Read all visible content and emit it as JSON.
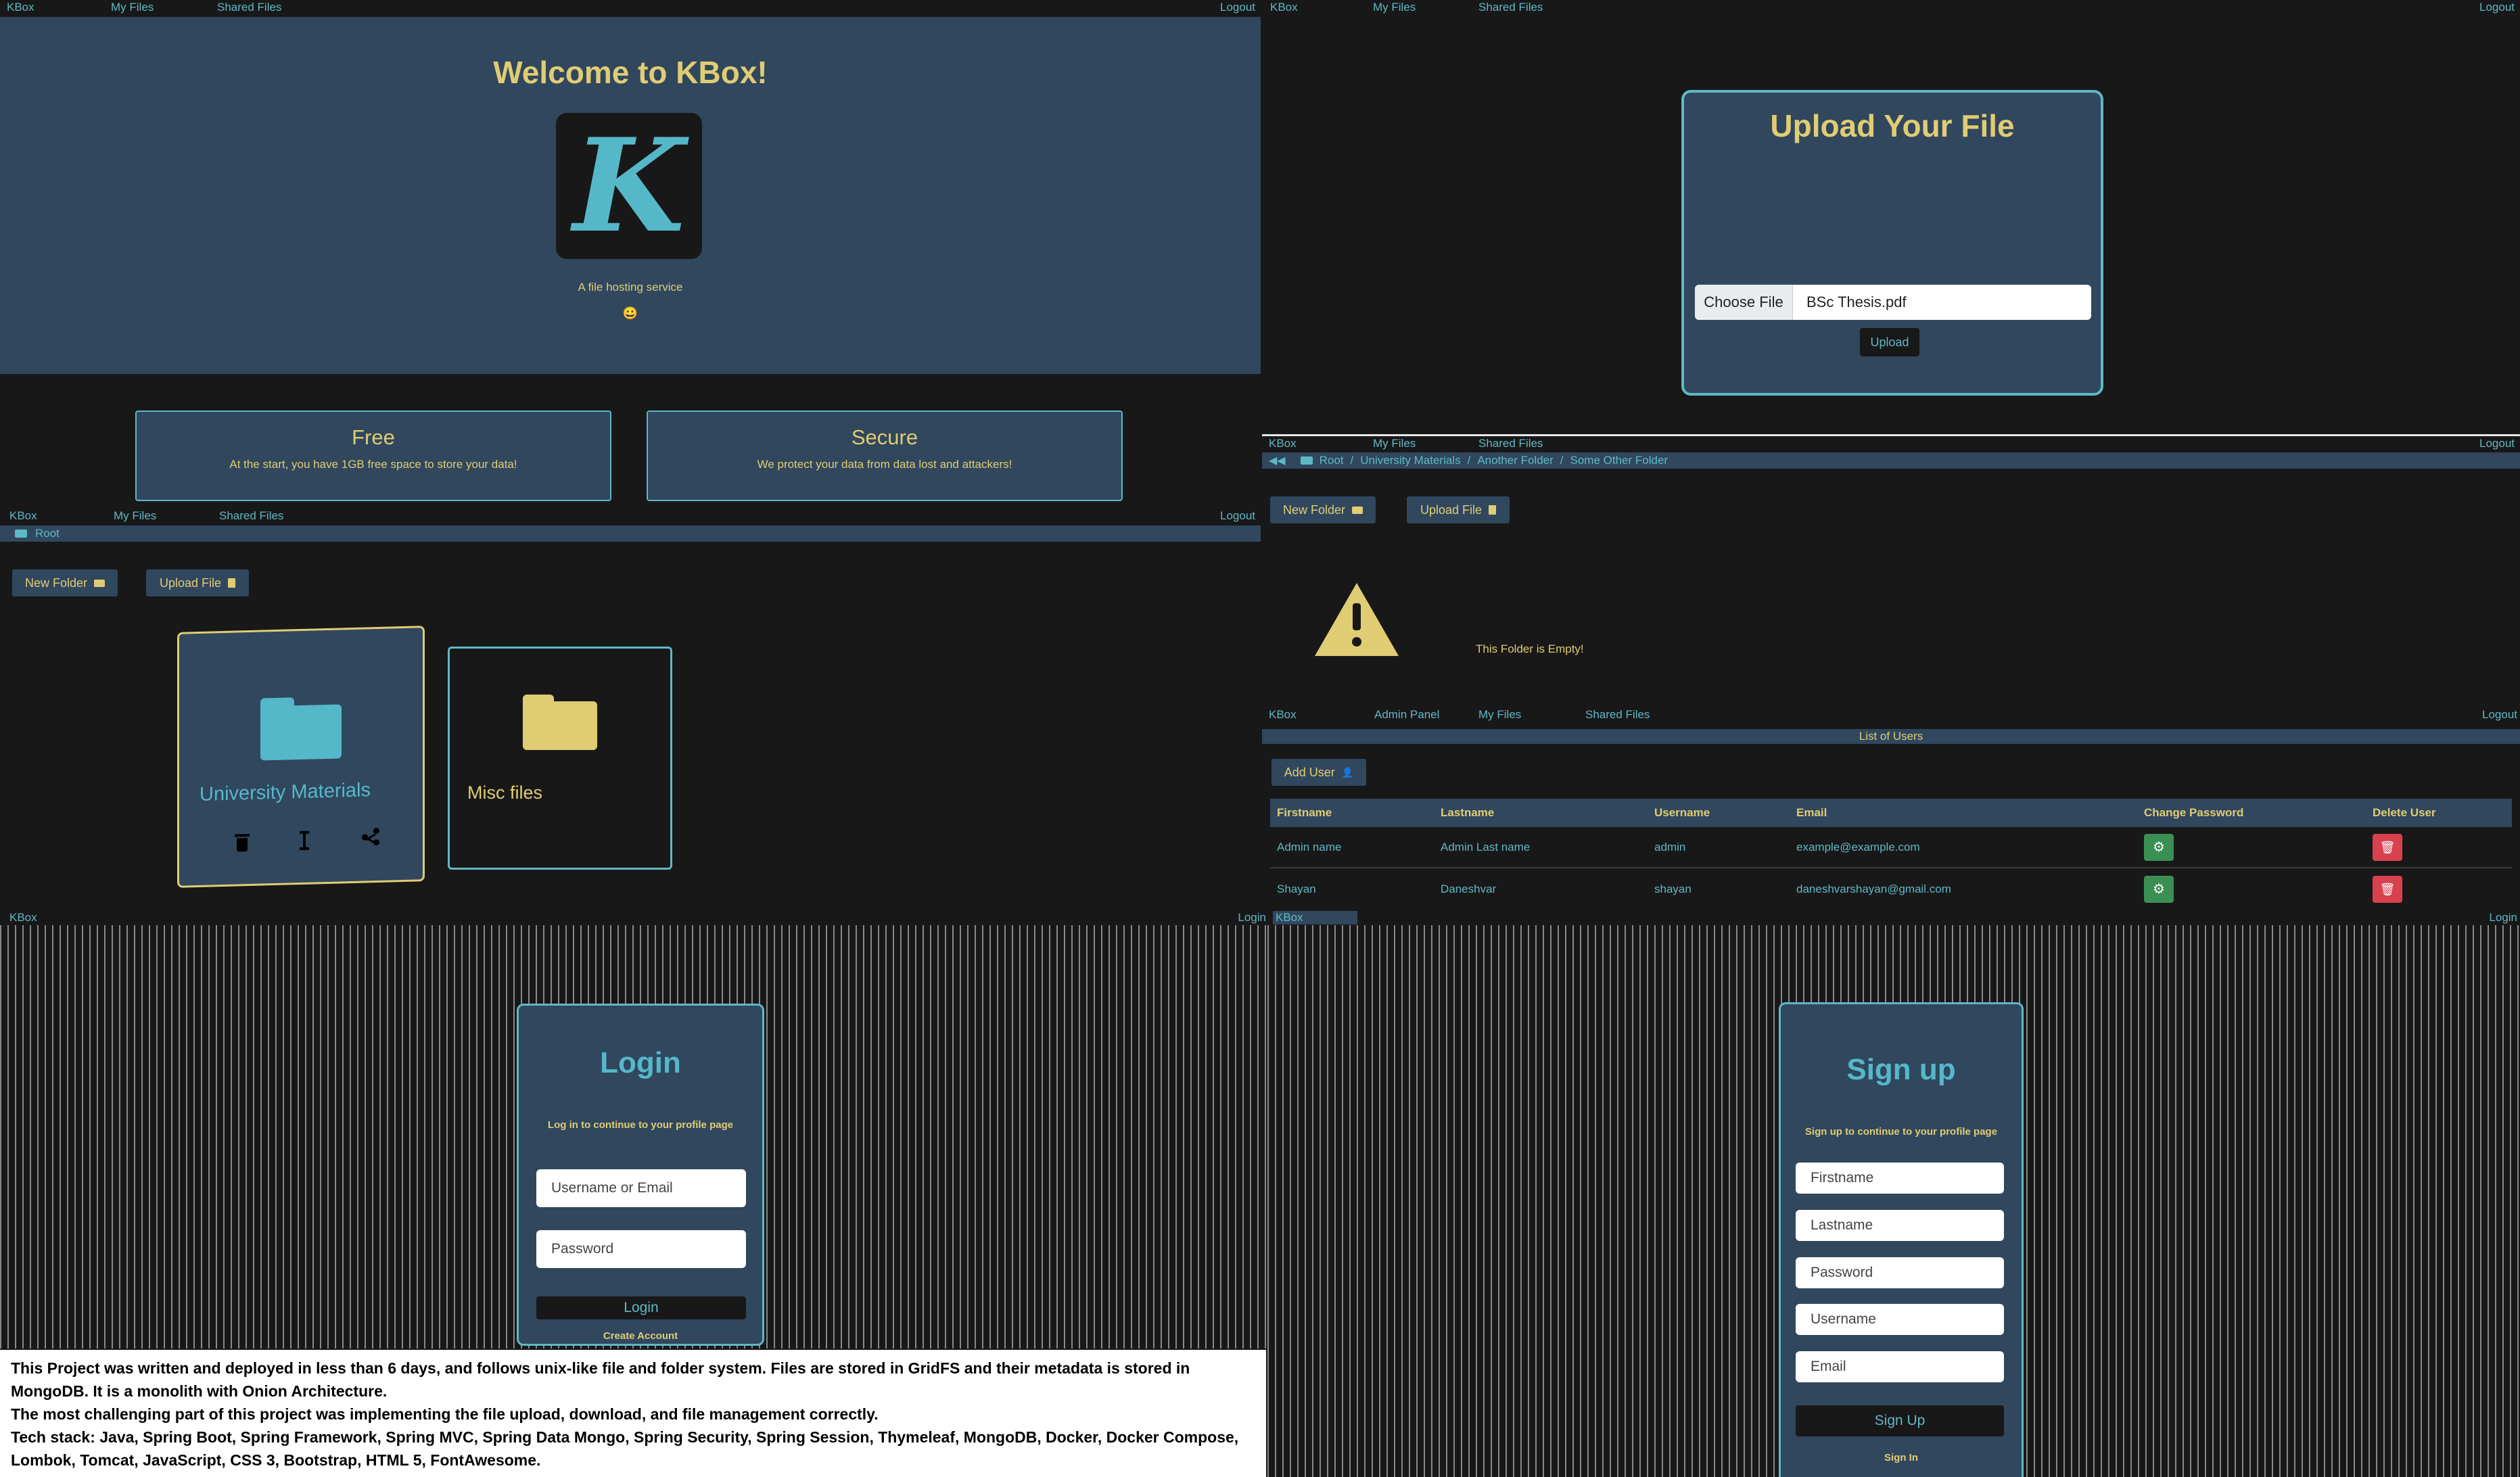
{
  "home": {
    "nav": {
      "brand": "KBox",
      "my_files": "My Files",
      "shared_files": "Shared Files",
      "logout": "Logout"
    },
    "welcome": "Welcome to KBox!",
    "logo_letter": "K",
    "tagline": "A file hosting service",
    "emoji": "😀",
    "features": [
      {
        "title": "Free",
        "text": "At the start, you have 1GB free space to store your data!"
      },
      {
        "title": "Secure",
        "text": "We protect your data from data lost and attackers!"
      }
    ]
  },
  "upload": {
    "nav": {
      "brand": "KBox",
      "my_files": "My Files",
      "shared_files": "Shared Files",
      "logout": "Logout"
    },
    "title": "Upload Your File",
    "choose_label": "Choose File",
    "file_name": "BSc Thesis.pdf",
    "upload_button": "Upload"
  },
  "files": {
    "nav": {
      "brand": "KBox",
      "my_files": "My Files",
      "shared_files": "Shared Files",
      "logout": "Logout"
    },
    "breadcrumb_root": "Root",
    "new_folder": "New Folder",
    "upload_file": "Upload File",
    "folders": [
      {
        "name": "University Materials",
        "color": "#55b8c9"
      },
      {
        "name": "Misc files",
        "color": "#e0cc73"
      }
    ]
  },
  "empty": {
    "nav": {
      "brand": "KBox",
      "my_files": "My Files",
      "shared_files": "Shared Files",
      "logout": "Logout"
    },
    "breadcrumb": [
      "Root",
      "University Materials",
      "Another Folder",
      "Some Other Folder"
    ],
    "new_folder": "New Folder",
    "upload_file": "Upload File",
    "message": "This Folder is Empty!"
  },
  "admin": {
    "nav": {
      "brand": "KBox",
      "admin_panel": "Admin Panel",
      "my_files": "My Files",
      "shared_files": "Shared Files",
      "logout": "Logout"
    },
    "header": "List of Users",
    "add_user": "Add User",
    "columns": [
      "Firstname",
      "Lastname",
      "Username",
      "Email",
      "Change Password",
      "Delete User"
    ],
    "rows": [
      {
        "firstname": "Admin name",
        "lastname": "Admin Last name",
        "username": "admin",
        "email": "example@example.com"
      },
      {
        "firstname": "Shayan",
        "lastname": "Daneshvar",
        "username": "shayan",
        "email": "daneshvarshayan@gmail.com"
      }
    ]
  },
  "login": {
    "nav": {
      "brand": "KBox",
      "login": "Login"
    },
    "title": "Login",
    "subtitle": "Log in to continue to your profile page",
    "username_placeholder": "Username or Email",
    "password_placeholder": "Password",
    "button": "Login",
    "create_account": "Create Account"
  },
  "signup": {
    "nav": {
      "brand": "KBox",
      "login": "Login"
    },
    "title": "Sign up",
    "subtitle": "Sign up to continue to your profile page",
    "fields": [
      "Firstname",
      "Lastname",
      "Password",
      "Username",
      "Email"
    ],
    "button": "Sign Up",
    "signin": "Sign In"
  },
  "description": {
    "line1": "This Project was written and deployed in less than 6 days, and follows unix-like file and folder system. Files are stored in GridFS and their metadata is stored in MongoDB. It is a monolith with Onion Architecture.",
    "line2": "The most challenging part of this project was implementing the file upload, download, and file management correctly.",
    "line3": "Tech stack: Java, Spring Boot, Spring Framework, Spring MVC, Spring Data Mongo, Spring Security, Spring Session, Thymeleaf, MongoDB, Docker, Docker Compose, Lombok, Tomcat, JavaScript, CSS 3, Bootstrap, HTML 5, FontAwesome."
  },
  "colors": {
    "navy": "#30475e",
    "dark": "#181818",
    "gold": "#e0cc73",
    "teal": "#55b8c9",
    "green": "#3a8f52",
    "red": "#d9414f"
  }
}
